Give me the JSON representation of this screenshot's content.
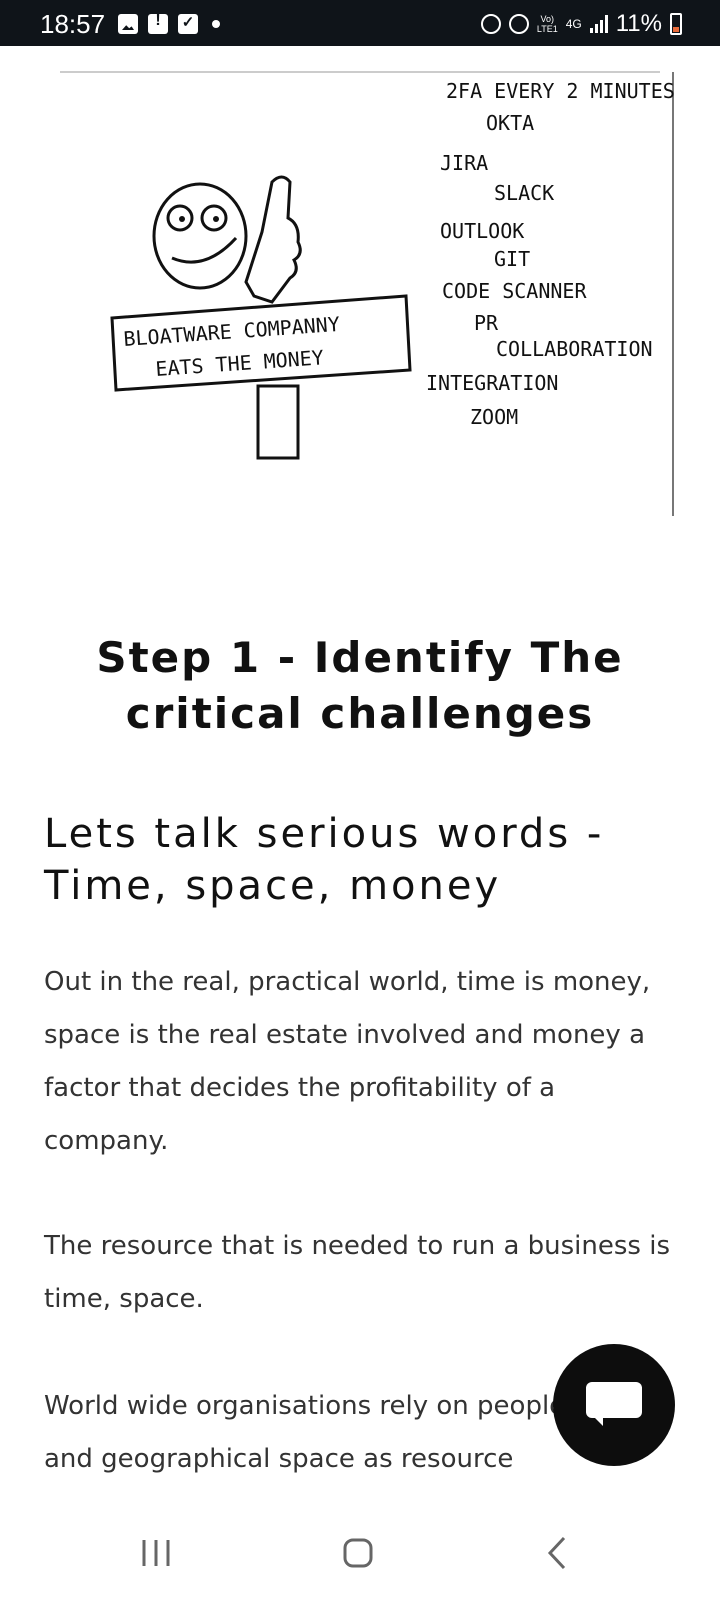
{
  "status_bar": {
    "time": "18:57",
    "network_top": "Vo)",
    "network_bottom": "LTE1",
    "network_type": "4G",
    "battery": "11%",
    "battery_color": "#e86a3a"
  },
  "illustration": {
    "sign_line1": "BLOATWARE COMPANNY",
    "sign_line2": "EATS THE MONEY",
    "tools": [
      "2FA EVERY 2 MINUTES",
      "OKTA",
      "JIRA",
      "SLACK",
      "OUTLOOK",
      "GIT",
      "CODE SCANNER",
      "PR",
      "COLLABORATION",
      "INTEGRATION",
      "ZOOM"
    ]
  },
  "article": {
    "step_heading": "Step 1 - Identify The critical challenges",
    "subheading": "Lets talk serious words - Time, space, money",
    "paragraphs": [
      "Out in the real, practical world, time is money, space is the real estate involved and money a factor that decides the profitability of a company.",
      "The resource that is needed to run a business is time, space.",
      "World wide organisations rely on people, time and geographical space as resource"
    ]
  },
  "chat_fab": {
    "icon": "chat-bubble-icon"
  },
  "nav_bar": {
    "icons": [
      "recents-icon",
      "home-icon",
      "back-icon"
    ]
  }
}
